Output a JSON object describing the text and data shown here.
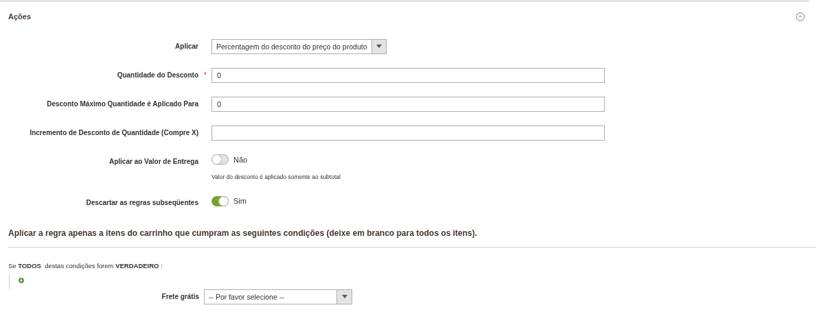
{
  "section": {
    "title": "Ações",
    "expanded": true
  },
  "fields": [
    {
      "kind": "select",
      "label": "Aplicar",
      "value": "Percentagem do desconto do preço do produto"
    },
    {
      "kind": "input",
      "label": "Quantidade do Desconto",
      "required_mark": "*",
      "value": "0"
    },
    {
      "kind": "input",
      "label": "Desconto Máximo Quantidade é Aplicado Para",
      "value": "0"
    },
    {
      "kind": "input",
      "label": "Incremento de Desconto de Quantidade (Compre X)"
    },
    {
      "kind": "toggle",
      "label": "Aplicar ao Valor de Entrega",
      "on": false,
      "text": "Não",
      "note": "Valor do desconto é aplicado somente ao subtotal"
    },
    {
      "kind": "toggle",
      "label": "Descartar as regras subseqüentes",
      "on": true,
      "text": "Sim"
    }
  ],
  "conditions": {
    "title": "Aplicar a regra apenas a itens do carrinho que cumpram as seguintes condições (deixe em branco para todos os itens).",
    "rule": "Se **TODOS**  destas condições forem **VERDADEIRO** :",
    "fields": [
      {
        "kind": "select",
        "label": "Frete grátis",
        "value": "-- Por favor selecione --"
      }
    ]
  }
}
